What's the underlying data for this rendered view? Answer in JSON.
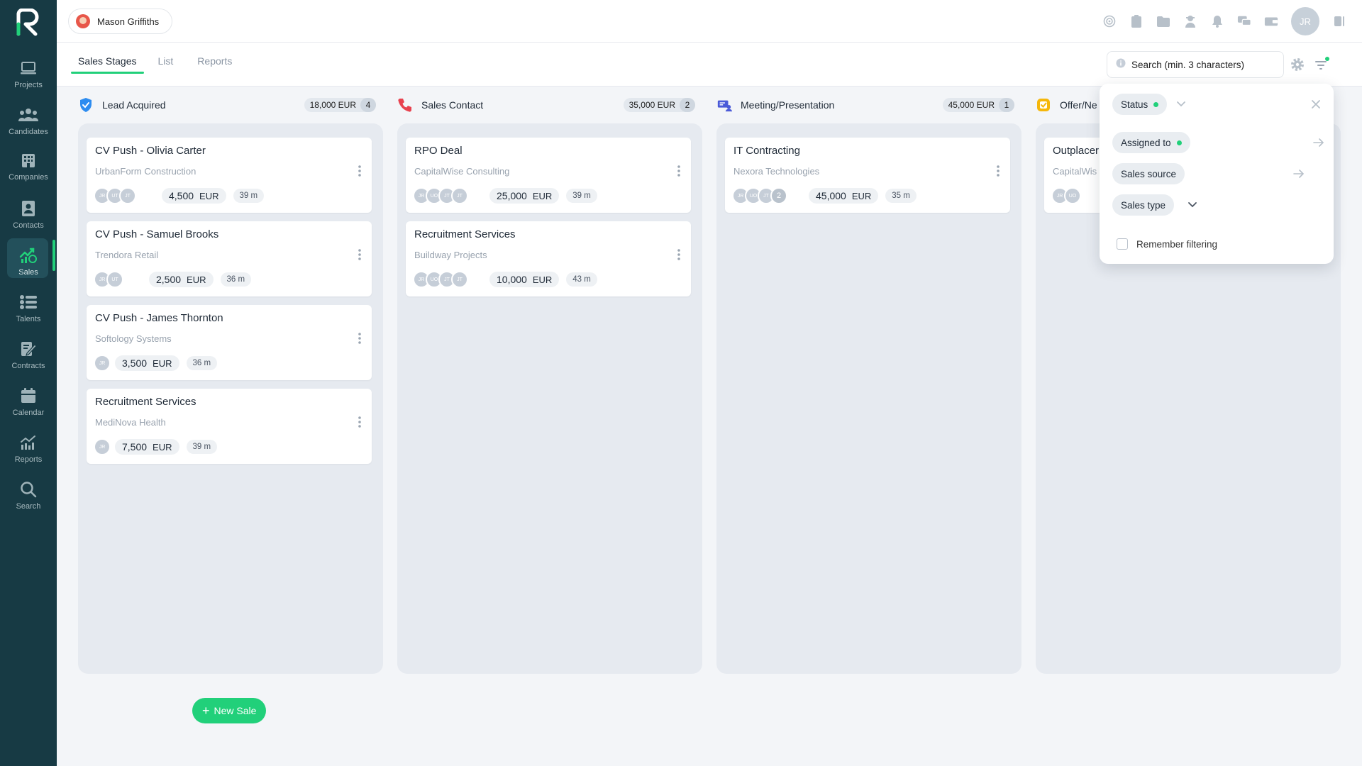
{
  "user": {
    "name": "Mason Griffiths"
  },
  "top_avatar": "JR",
  "nav": [
    {
      "label": "Projects",
      "icon": "laptop-icon"
    },
    {
      "label": "Candidates",
      "icon": "people-icon"
    },
    {
      "label": "Companies",
      "icon": "building-icon"
    },
    {
      "label": "Contacts",
      "icon": "contact-card-icon"
    },
    {
      "label": "Sales",
      "icon": "sales-chart-icon",
      "active": true
    },
    {
      "label": "Talents",
      "icon": "list-icon"
    },
    {
      "label": "Contracts",
      "icon": "contract-pen-icon"
    },
    {
      "label": "Calendar",
      "icon": "calendar-icon"
    },
    {
      "label": "Reports",
      "icon": "bar-chart-icon"
    },
    {
      "label": "Search",
      "icon": "search-icon"
    }
  ],
  "tabs": [
    {
      "label": "Sales Stages",
      "active": true
    },
    {
      "label": "List"
    },
    {
      "label": "Reports"
    }
  ],
  "search": {
    "placeholder": "Search (min. 3 characters)"
  },
  "columns": [
    {
      "title": "Lead Acquired",
      "total": "18,000",
      "currency": "EUR",
      "count": "4",
      "icon": "shield-check-icon",
      "cards": [
        {
          "title": "CV Push - Olivia Carter",
          "company": "UrbanForm Construction",
          "avatars": [
            "JR",
            "UT",
            "JT"
          ],
          "amount": "4,500",
          "currency": "EUR",
          "age": "39 m"
        },
        {
          "title": "CV Push - Samuel Brooks",
          "company": "Trendora Retail",
          "avatars": [
            "JR",
            "UT"
          ],
          "amount": "2,500",
          "currency": "EUR",
          "age": "36 m"
        },
        {
          "title": "CV Push - James Thornton",
          "company": "Softology Systems",
          "avatars": [
            "JR"
          ],
          "amount": "3,500",
          "currency": "EUR",
          "age": "36 m"
        },
        {
          "title": "Recruitment Services",
          "company": "MediNova Health",
          "avatars": [
            "JR"
          ],
          "amount": "7,500",
          "currency": "EUR",
          "age": "39 m"
        }
      ]
    },
    {
      "title": "Sales Contact",
      "total": "35,000",
      "currency": "EUR",
      "count": "2",
      "icon": "phone-icon",
      "cards": [
        {
          "title": "RPO Deal",
          "company": "CapitalWise Consulting",
          "avatars": [
            "JR",
            "UO",
            "JT",
            "JT"
          ],
          "amount": "25,000",
          "currency": "EUR",
          "age": "39 m"
        },
        {
          "title": "Recruitment Services",
          "company": "Buildway Projects",
          "avatars": [
            "JR",
            "UO",
            "JT",
            "JT"
          ],
          "amount": "10,000",
          "currency": "EUR",
          "age": "43 m"
        }
      ]
    },
    {
      "title": "Meeting/Presentation",
      "total": "45,000",
      "currency": "EUR",
      "count": "1",
      "icon": "meeting-icon",
      "cards": [
        {
          "title": "IT Contracting",
          "company": "Nexora Technologies",
          "avatars": [
            "JR",
            "UO",
            "JT",
            "2"
          ],
          "amount": "45,000",
          "currency": "EUR",
          "age": "35 m"
        }
      ]
    },
    {
      "title": "Offer/Ne",
      "icon": "offer-icon",
      "cards": [
        {
          "title": "Outplacer",
          "company": "CapitalWis",
          "avatars": [
            "JR",
            "UO"
          ]
        }
      ]
    }
  ],
  "new_sale_label": "New Sale",
  "filter_panel": {
    "status": "Status",
    "assigned_to": "Assigned to",
    "sales_source": "Sales source",
    "sales_type": "Sales type",
    "remember": "Remember filtering"
  },
  "colors": {
    "sidebar": "#173a44",
    "accent": "#21d07a"
  }
}
